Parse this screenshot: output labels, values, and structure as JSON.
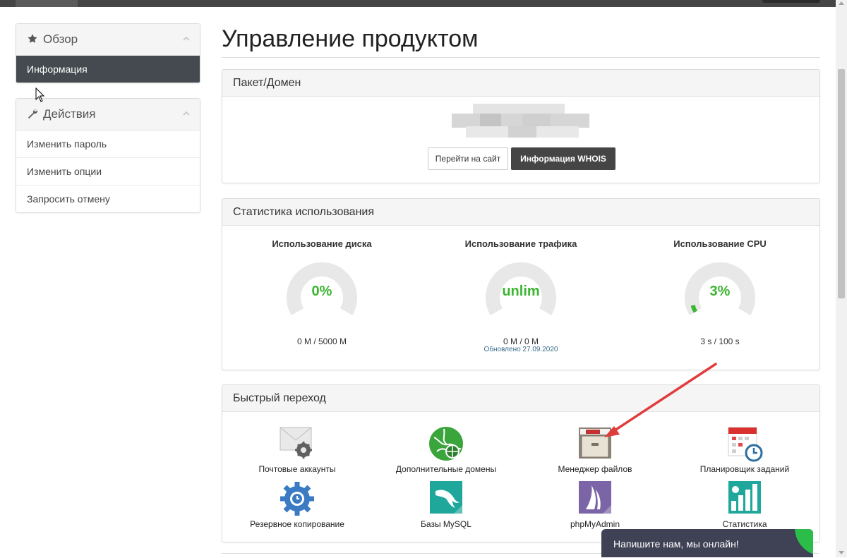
{
  "sidebar": {
    "overview": {
      "title": "Обзор",
      "active_item": "Информация"
    },
    "actions": {
      "title": "Действия",
      "items": [
        "Изменить пароль",
        "Изменить опции",
        "Запросить отмену"
      ]
    }
  },
  "main": {
    "page_title": "Управление продуктом",
    "package": {
      "heading": "Пакет/Домен",
      "visit_button": "Перейти на сайт",
      "whois_button": "Информация WHOIS"
    },
    "usage": {
      "heading": "Статистика использования",
      "disk": {
        "title": "Использование диска",
        "value": "0%",
        "detail": "0 M / 5000 M",
        "fraction": 0.0
      },
      "traffic": {
        "title": "Использование трафика",
        "value": "unlim",
        "detail": "0 M / 0 M",
        "fraction": 0.0
      },
      "cpu": {
        "title": "Использование CPU",
        "value": "3%",
        "detail": "3 s / 100 s",
        "fraction": 0.03
      },
      "updated": "Обновлено 27.09.2020"
    },
    "quick": {
      "heading": "Быстрый переход",
      "items": [
        {
          "label": "Почтовые аккаунты",
          "icon": "mail-accounts-icon"
        },
        {
          "label": "Дополнительные домены",
          "icon": "globe-icon"
        },
        {
          "label": "Менеджер файлов",
          "icon": "file-cabinet-icon"
        },
        {
          "label": "Планировщик заданий",
          "icon": "calendar-clock-icon"
        },
        {
          "label": "Резервное копирование",
          "icon": "backup-gear-icon"
        },
        {
          "label": "Базы MySQL",
          "icon": "mysql-dolphin-icon"
        },
        {
          "label": "phpMyAdmin",
          "icon": "phpmyadmin-sail-icon"
        },
        {
          "label": "Статистика",
          "icon": "statistics-bars-icon"
        }
      ]
    }
  },
  "chat": {
    "label": "Напишите нам, мы онлайн!"
  },
  "colors": {
    "gauge_green": "#3cb531",
    "gauge_track": "#e8e8e8",
    "dark_button": "#454545",
    "chat_bg": "#3f4155",
    "arrow_red": "#e03c3c"
  }
}
